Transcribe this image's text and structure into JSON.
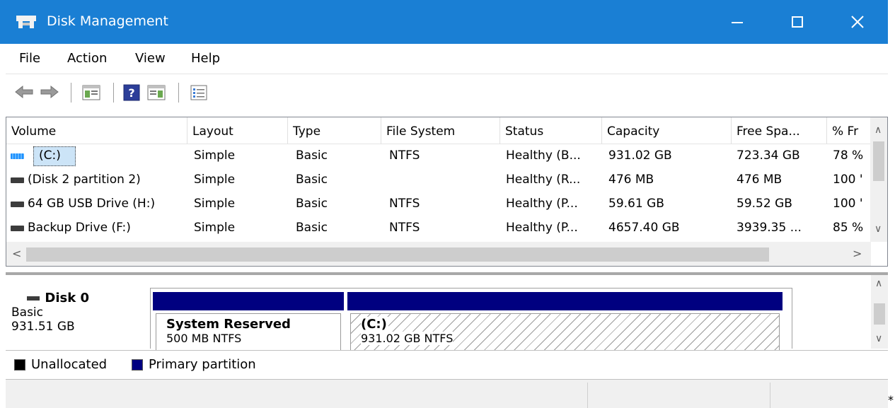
{
  "window": {
    "title": "Disk Management",
    "accent": "#1a7fd4"
  },
  "menu": [
    "File",
    "Action",
    "View",
    "Help"
  ],
  "toolbar": {
    "icons": [
      "back-arrow-icon",
      "forward-arrow-icon",
      "console-tree-icon",
      "help-icon",
      "action-pane-icon",
      "properties-icon"
    ]
  },
  "volume_list": {
    "columns": [
      "Volume",
      "Layout",
      "Type",
      "File System",
      "Status",
      "Capacity",
      "Free Spa...",
      "% Fr"
    ],
    "rows": [
      {
        "volume": "(C:)",
        "layout": "Simple",
        "type": "Basic",
        "fs": "NTFS",
        "status": "Healthy (B...",
        "capacity": "931.02 GB",
        "free": "723.34 GB",
        "pct": "78 %"
      },
      {
        "volume": "(Disk 2 partition 2)",
        "layout": "Simple",
        "type": "Basic",
        "fs": "",
        "status": "Healthy (R...",
        "capacity": "476 MB",
        "free": "476 MB",
        "pct": "100 '"
      },
      {
        "volume": "64 GB USB Drive (H:)",
        "layout": "Simple",
        "type": "Basic",
        "fs": "NTFS",
        "status": "Healthy (P...",
        "capacity": "59.61 GB",
        "free": "59.52 GB",
        "pct": "100 '"
      },
      {
        "volume": "Backup Drive (F:)",
        "layout": "Simple",
        "type": "Basic",
        "fs": "NTFS",
        "status": "Healthy (P...",
        "capacity": "4657.40 GB",
        "free": "3939.35 ...",
        "pct": "85 %"
      }
    ]
  },
  "disk": {
    "name": "Disk 0",
    "type": "Basic",
    "size": "931.51 GB",
    "partitions": [
      {
        "title": "System Reserved",
        "info": "500 MB NTFS"
      },
      {
        "title": "(C:)",
        "info": "931.02 GB NTFS"
      }
    ]
  },
  "legend": [
    {
      "label": "Unallocated",
      "color": "#000000"
    },
    {
      "label": "Primary partition",
      "color": "#000080"
    }
  ],
  "status": {
    "text": "*"
  }
}
